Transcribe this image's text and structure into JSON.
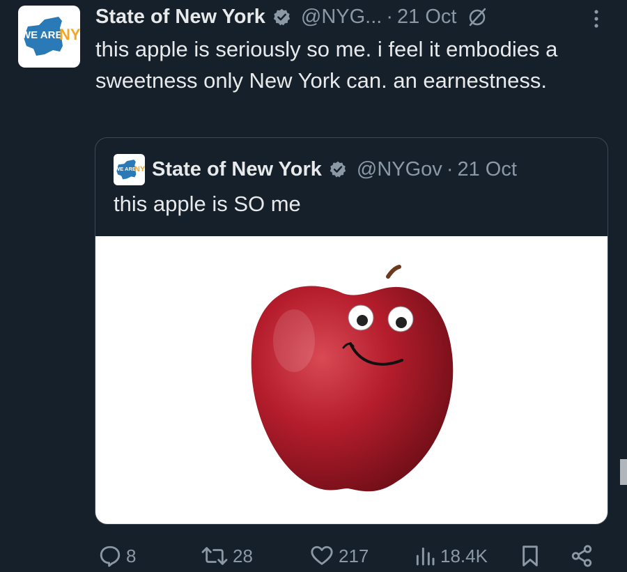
{
  "tweet": {
    "author_name": "State of New York",
    "handle": "@NYG...",
    "separator": "·",
    "date": "21 Oct",
    "text": "this apple is seriously so me. i feel it embodies a sweetness only New York can. an earnestness.",
    "avatar_logo": {
      "we_are": "WE ARE",
      "ny": "NY"
    }
  },
  "quoted_tweet": {
    "author_name": "State of New York",
    "handle": "@NYGov",
    "separator": "·",
    "date": "21 Oct",
    "text": "this apple is SO me",
    "avatar_logo": {
      "we_are": "WE ARE",
      "ny": "NY"
    }
  },
  "actions": {
    "replies": "8",
    "reposts": "28",
    "likes": "217",
    "views": "18.4K"
  },
  "colors": {
    "background": "#15202b",
    "primary_text": "#e7e9ea",
    "secondary_text": "#8b98a5",
    "verified_badge": "#8b98a5",
    "logo_blue": "#2a7ab8",
    "logo_gold": "#f5a623"
  },
  "icons": [
    "verified-icon",
    "not-interested-icon",
    "more-icon",
    "reply-icon",
    "repost-icon",
    "like-icon",
    "views-icon",
    "bookmark-icon",
    "share-icon"
  ]
}
